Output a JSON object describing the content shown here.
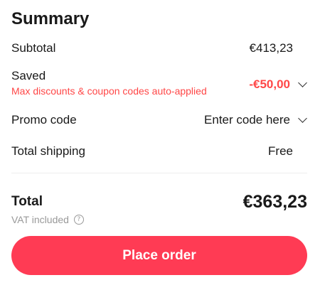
{
  "summary": {
    "title": "Summary",
    "subtotal": {
      "label": "Subtotal",
      "value": "€413,23"
    },
    "saved": {
      "label": "Saved",
      "note": "Max discounts & coupon codes auto-applied",
      "value": "-€50,00"
    },
    "promo": {
      "label": "Promo code",
      "placeholder": "Enter code here"
    },
    "shipping": {
      "label": "Total shipping",
      "value": "Free"
    },
    "total": {
      "label": "Total",
      "value": "€363,23"
    },
    "vat_note": "VAT included",
    "help_glyph": "?",
    "place_order_label": "Place order"
  },
  "colors": {
    "accent": "#ff3b54",
    "discount": "#ff4747",
    "muted": "#999999",
    "text": "#191919"
  }
}
